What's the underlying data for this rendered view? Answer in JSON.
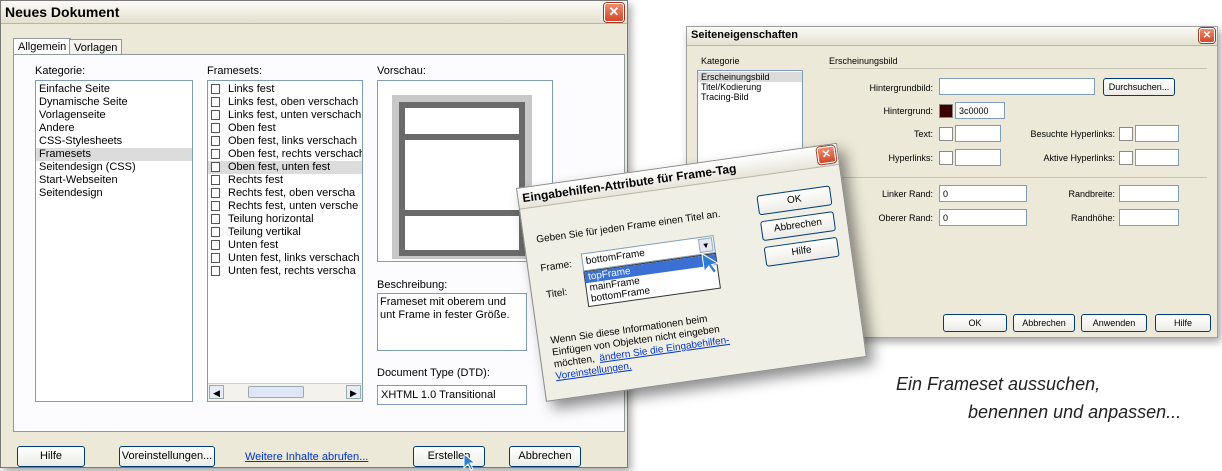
{
  "neues": {
    "title": "Neues Dokument",
    "tabs": [
      "Allgemein",
      "Vorlagen"
    ],
    "kategorie_label": "Kategorie:",
    "kategorien": [
      "Einfache Seite",
      "Dynamische Seite",
      "Vorlagenseite",
      "Andere",
      "CSS-Stylesheets",
      "Framesets",
      "Seitendesign (CSS)",
      "Start-Webseiten",
      "Seitendesign"
    ],
    "framesets_label": "Framesets:",
    "framesets": [
      "Links fest",
      "Links fest, oben verschach",
      "Links fest, unten verschachl",
      "Oben fest",
      "Oben fest, links verschach",
      "Oben fest, rechts verschach",
      "Oben fest, unten fest",
      "Rechts fest",
      "Rechts fest, oben verscha",
      "Rechts fest, unten versche",
      "Teilung horizontal",
      "Teilung vertikal",
      "Unten fest",
      "Unten fest, links verschach",
      "Unten fest, rechts verscha"
    ],
    "vorschau_label": "Vorschau:",
    "beschreibung_label": "Beschreibung:",
    "beschreibung_text": "Frameset mit oberem und unt Frame in fester Größe.",
    "doctype_label": "Document Type (DTD):",
    "doctype_value": "XHTML 1.0 Transitional",
    "hilfe": "Hilfe",
    "voreinstellungen": "Voreinstellungen...",
    "weitere": "Weitere Inhalte abrufen...",
    "erstellen": "Erstellen",
    "abbrechen": "Abbrechen"
  },
  "seite": {
    "title": "Seiteneigenschaften",
    "kategorie_label": "Kategorie",
    "kategorien": [
      "Erscheinungsbild",
      "Titel/Kodierung",
      "Tracing-Bild"
    ],
    "section": "Erscheinungsbild",
    "hintergrundbild": "Hintergrundbild:",
    "durchsuchen": "Durchsuchen...",
    "hintergrund": "Hintergrund:",
    "hintergrund_value": "3c0000",
    "hintergrund_color": "#3c0000",
    "text": "Text:",
    "besuchte": "Besuchte Hyperlinks:",
    "hyperlinks": "Hyperlinks:",
    "aktive": "Aktive Hyperlinks:",
    "linker": "Linker Rand:",
    "linker_value": "0",
    "randbreite": "Randbreite:",
    "oberer": "Oberer Rand:",
    "oberer_value": "0",
    "randhoehe": "Randhöhe:",
    "ok": "OK",
    "abbrechen": "Abbrechen",
    "anwenden": "Anwenden",
    "hilfe": "Hilfe"
  },
  "eingabe": {
    "title": "Eingabehilfen-Attribute für Frame-Tag",
    "intro": "Geben Sie für jeden Frame einen Titel an.",
    "frame_label": "Frame:",
    "frame_value": "bottomFrame",
    "titel_label": "Titel:",
    "options": [
      "topFrame",
      "mainFrame",
      "bottomFrame"
    ],
    "info_line1": "Wenn Sie diese Informationen beim",
    "info_line2": "Einfügen von Objekten nicht eingeben",
    "info_line3": "möchten,",
    "info_link1": "ändern Sie die Eingabehilfen-",
    "info_link2": "Voreinstellungen.",
    "ok": "OK",
    "abbrechen": "Abbrechen",
    "hilfe": "Hilfe"
  },
  "caption": {
    "line1": "Ein Frameset aussuchen,",
    "line2": "benennen und anpassen..."
  }
}
